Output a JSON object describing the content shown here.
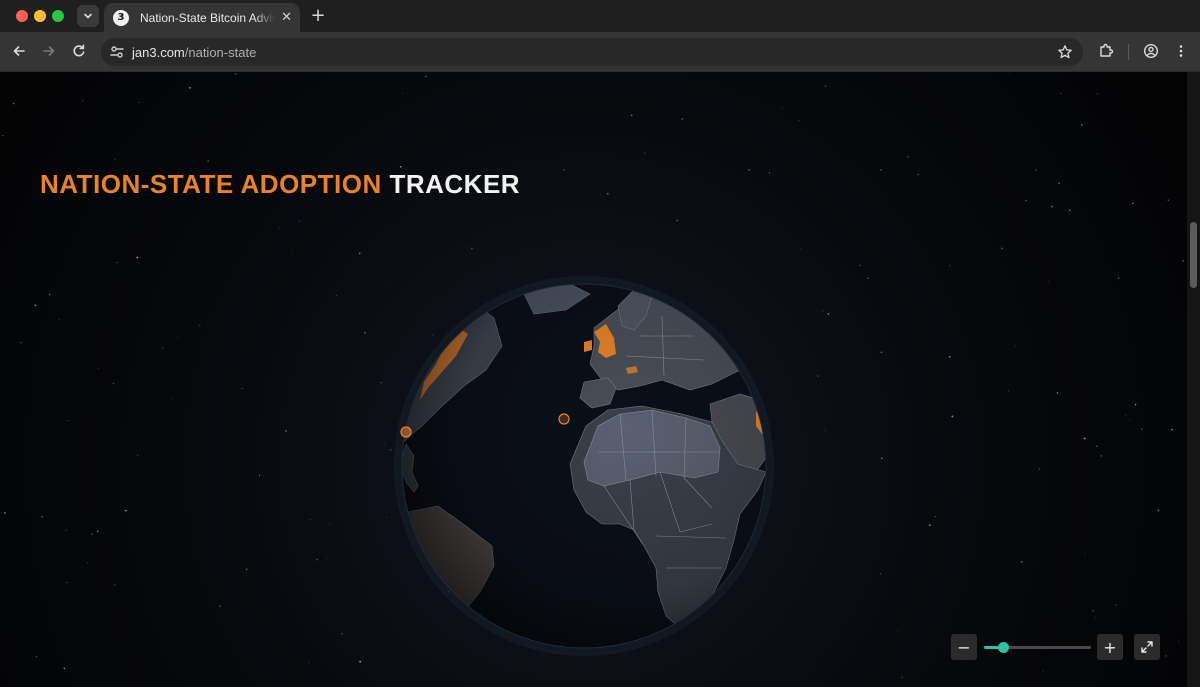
{
  "browser": {
    "tab": {
      "title": "Nation-State Bitcoin Advisory",
      "favicon_glyph": "3",
      "close_glyph": "✕"
    },
    "new_tab_glyph": "+",
    "address": {
      "host": "jan3.com",
      "path": "/nation-state"
    }
  },
  "page": {
    "title_accent": "NATION-STATE ADOPTION",
    "title_plain": "TRACKER",
    "zoom": {
      "minus_label": "−",
      "plus_label": "+",
      "level": 0.18
    },
    "scroll_position": 0.27
  },
  "colors": {
    "accent": "#e8832a",
    "slider": "#2ec4a0",
    "land": "#3a4049",
    "land_light": "#5a6070",
    "ocean": "#0b0f18",
    "adopter": "#e8832a"
  },
  "icons": {
    "tab_search": "chevron-down-icon",
    "back": "arrow-left-icon",
    "forward": "arrow-right-icon",
    "reload": "reload-icon",
    "site_info": "tune-icon",
    "bookmark": "star-icon",
    "extensions": "puzzle-icon",
    "profile": "person-icon",
    "menu": "kebab-icon",
    "fullscreen": "expand-icon"
  }
}
